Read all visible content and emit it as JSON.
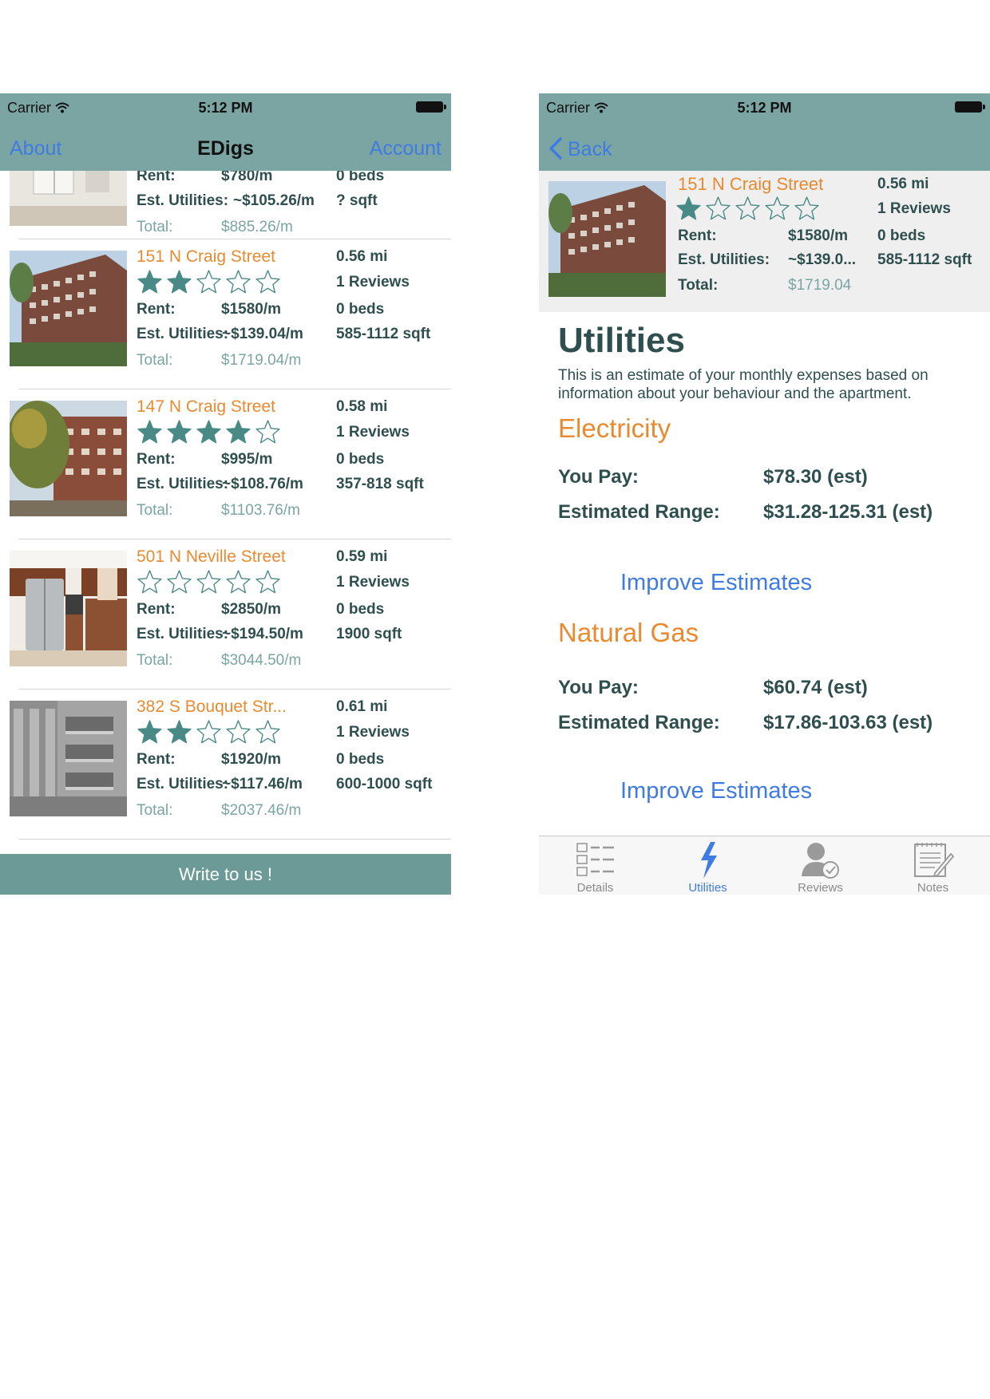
{
  "colors": {
    "bar": "#7ba5a2",
    "accent_orange": "#e88a30",
    "link_blue": "#3f7be0",
    "star_teal": "#4a8a86",
    "text_dark": "#2f4f4f"
  },
  "status_bar": {
    "carrier": "Carrier",
    "time": "5:12 PM"
  },
  "list_screen": {
    "nav": {
      "left": "About",
      "title": "EDigs",
      "right": "Account"
    },
    "top_partial": {
      "rent_label": "Rent:",
      "rent": "$780/m",
      "beds": "0 beds",
      "util_label": "Est. Utilities:",
      "util": "~$105.26/m",
      "sqft": "? sqft",
      "total_label": "Total:",
      "total": "$885.26/m"
    },
    "listings": [
      {
        "address": "151 N Craig Street",
        "distance": "0.56 mi",
        "rating": 2,
        "reviews": "1 Reviews",
        "rent_label": "Rent:",
        "rent": "$1580/m",
        "beds": "0 beds",
        "util_label": "Est. Utilities:",
        "util": "~$139.04/m",
        "sqft": "585-1112 sqft",
        "total_label": "Total:",
        "total": "$1719.04/m"
      },
      {
        "address": "147 N Craig Street",
        "distance": "0.58 mi",
        "rating": 4,
        "reviews": "1 Reviews",
        "rent_label": "Rent:",
        "rent": "$995/m",
        "beds": "0 beds",
        "util_label": "Est. Utilities:",
        "util": "~$108.76/m",
        "sqft": "357-818 sqft",
        "total_label": "Total:",
        "total": "$1103.76/m"
      },
      {
        "address": "501 N Neville Street",
        "distance": "0.59 mi",
        "rating": 0,
        "reviews": "1 Reviews",
        "rent_label": "Rent:",
        "rent": "$2850/m",
        "beds": "0 beds",
        "util_label": "Est. Utilities:",
        "util": "~$194.50/m",
        "sqft": "1900 sqft",
        "total_label": "Total:",
        "total": "$3044.50/m"
      },
      {
        "address": "382 S Bouquet Str...",
        "distance": "0.61 mi",
        "rating": 2,
        "reviews": "1 Reviews",
        "rent_label": "Rent:",
        "rent": "$1920/m",
        "beds": "0 beds",
        "util_label": "Est. Utilities:",
        "util": "~$117.46/m",
        "sqft": "600-1000 sqft",
        "total_label": "Total:",
        "total": "$2037.46/m"
      }
    ],
    "footer_button": "Write to us !"
  },
  "detail_screen": {
    "nav": {
      "back": "Back"
    },
    "card": {
      "address": "151 N Craig Street",
      "distance": "0.56 mi",
      "rating": 1,
      "reviews": "1 Reviews",
      "rent_label": "Rent:",
      "rent": "$1580/m",
      "beds": "0 beds",
      "util_label": "Est. Utilities:",
      "util": "~$139.0...",
      "sqft": "585-1112 sqft",
      "total_label": "Total:",
      "total": "$1719.04"
    },
    "title": "Utilities",
    "description": "This is an estimate of your monthly expenses based on information about your behaviour and the apartment.",
    "electricity": {
      "heading": "Electricity",
      "you_pay_label": "You Pay:",
      "you_pay": "$78.30 (est)",
      "range_label": "Estimated Range:",
      "range": "$31.28-125.31 (est)",
      "improve": "Improve Estimates"
    },
    "gas": {
      "heading": "Natural Gas",
      "you_pay_label": "You Pay:",
      "you_pay": "$60.74 (est)",
      "range_label": "Estimated Range:",
      "range": "$17.86-103.63 (est)",
      "improve": "Improve Estimates"
    },
    "tabs": [
      {
        "label": "Details",
        "icon": "details-list-icon"
      },
      {
        "label": "Utilities",
        "icon": "lightning-bolt-icon",
        "active": true
      },
      {
        "label": "Reviews",
        "icon": "user-check-icon"
      },
      {
        "label": "Notes",
        "icon": "notepad-pencil-icon"
      }
    ]
  }
}
